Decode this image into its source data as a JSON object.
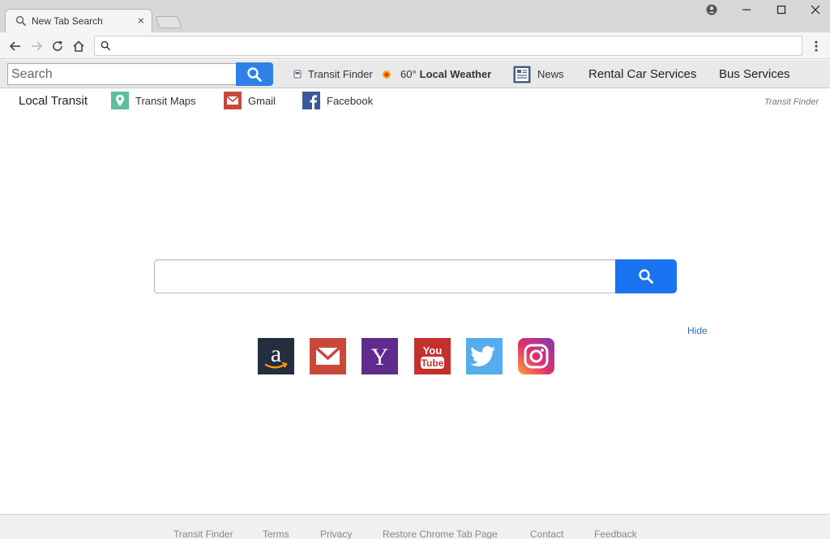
{
  "browser": {
    "tab_title": "New Tab Search",
    "tab_close": "×",
    "url": ""
  },
  "toolbar": {
    "search_placeholder": "Search",
    "transit_finder": "Transit Finder",
    "weather_temp": "60°",
    "weather_label": "Local Weather",
    "news": "News",
    "rental_car": "Rental Car Services",
    "bus_services": "Bus Services"
  },
  "links": {
    "local_transit": "Local Transit",
    "transit_maps": "Transit Maps",
    "gmail": "Gmail",
    "facebook": "Facebook",
    "brand": "Transit Finder"
  },
  "main": {
    "search_placeholder": "",
    "hide": "Hide",
    "tiles": [
      {
        "name": "amazon",
        "color": "#232f3e"
      },
      {
        "name": "gmail",
        "color": "#c9483b"
      },
      {
        "name": "yahoo",
        "color": "#5f2b8e"
      },
      {
        "name": "youtube",
        "color": "#c4302b"
      },
      {
        "name": "twitter",
        "color": "#55acee"
      },
      {
        "name": "instagram",
        "color": "#c13584"
      }
    ]
  },
  "footer": {
    "links": [
      "Transit Finder",
      "Terms",
      "Privacy",
      "Restore Chrome Tab Page",
      "Contact",
      "Feedback"
    ]
  },
  "colors": {
    "search_button": "#2f7fe8",
    "main_search_button": "#1a73f0",
    "hide_link": "#2f6db5"
  }
}
